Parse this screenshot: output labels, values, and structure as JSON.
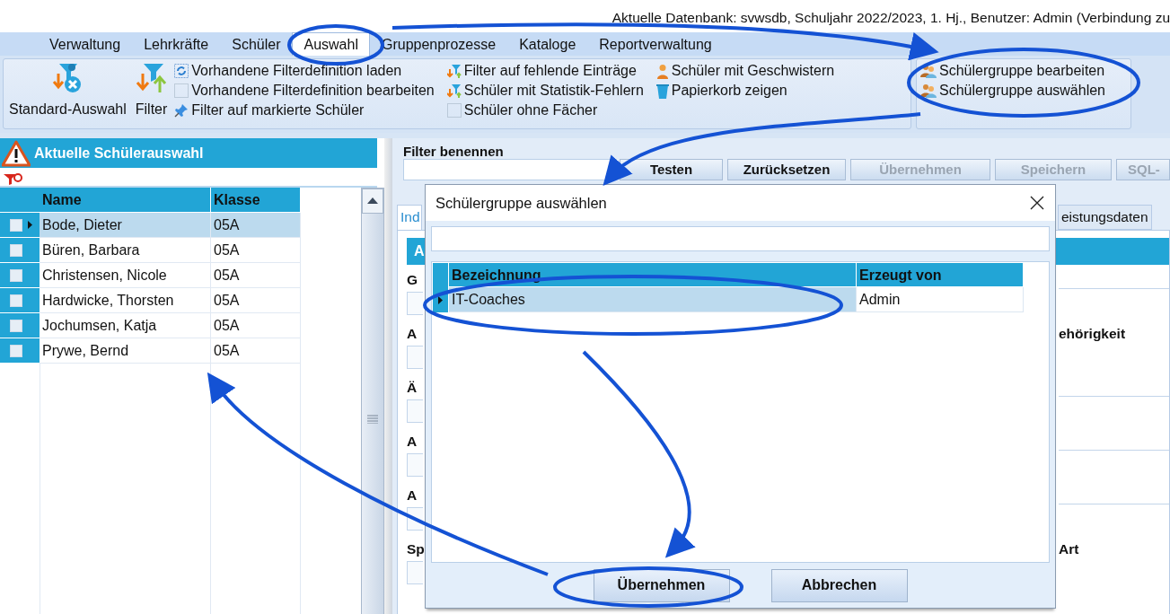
{
  "status_text": "Aktuelle Datenbank: svwsdb, Schuljahr 2022/2023, 1. Hj., Benutzer: Admin (Verbindung zu",
  "menu": [
    {
      "label": "Verwaltung",
      "selected": false
    },
    {
      "label": "Lehrkräfte",
      "selected": false
    },
    {
      "label": "Schüler",
      "selected": false
    },
    {
      "label": "Auswahl",
      "selected": true
    },
    {
      "label": "Gruppenprozesse",
      "selected": false
    },
    {
      "label": "Kataloge",
      "selected": false
    },
    {
      "label": "Reportverwaltung",
      "selected": false
    }
  ],
  "ribbon": {
    "large_buttons": [
      {
        "label": "Standard-Auswahl",
        "kind": "clear"
      },
      {
        "label": "Filter",
        "kind": "filter"
      }
    ],
    "columns": [
      [
        {
          "label": "Vorhandene Filterdefinition laden",
          "kind": "refresh"
        },
        {
          "label": "Vorhandene Filterdefinition bearbeiten",
          "kind": "empty"
        },
        {
          "label": "Filter auf markierte Schüler",
          "kind": "pin"
        }
      ],
      [
        {
          "label": "Filter auf fehlende Einträge",
          "kind": "funnel"
        },
        {
          "label": "Schüler mit Statistik-Fehlern",
          "kind": "funnel"
        },
        {
          "label": "Schüler ohne Fächer",
          "kind": "empty"
        }
      ],
      [
        {
          "label": "Schüler mit Geschwistern",
          "kind": "person"
        },
        {
          "label": "Papierkorb zeigen",
          "kind": "trash"
        }
      ]
    ],
    "group_items": [
      {
        "label": "Schülergruppe bearbeiten",
        "kind": "people"
      },
      {
        "label": "Schülergruppe auswählen",
        "kind": "people"
      }
    ]
  },
  "student_panel": {
    "title": "Aktuelle Schülerauswahl",
    "columns": [
      "Name",
      "Klasse"
    ],
    "rows": [
      {
        "name": "Bode, Dieter",
        "class": "05A",
        "selected": true,
        "checked": false
      },
      {
        "name": "Büren, Barbara",
        "class": "05A",
        "selected": false,
        "checked": false
      },
      {
        "name": "Christensen, Nicole",
        "class": "05A",
        "selected": false,
        "checked": false
      },
      {
        "name": "Hardwicke, Thorsten",
        "class": "05A",
        "selected": false,
        "checked": false
      },
      {
        "name": "Jochumsen, Katja",
        "class": "05A",
        "selected": false,
        "checked": false
      },
      {
        "name": "Prywe, Bernd",
        "class": "05A",
        "selected": false,
        "checked": false
      }
    ]
  },
  "filter_panel": {
    "label": "Filter benennen",
    "buttons": [
      {
        "label": "Testen",
        "disabled": false
      },
      {
        "label": "Zurücksetzen",
        "disabled": false
      },
      {
        "label": "Übernehmen",
        "disabled": true
      },
      {
        "label": "Speichern",
        "disabled": true
      },
      {
        "label": "SQL-",
        "disabled": true
      }
    ],
    "tabs": [
      {
        "label": "Ind",
        "selected": true
      },
      {
        "label": "eistungsdaten",
        "selected": false
      }
    ],
    "section_header": "A",
    "form_rows": [
      {
        "left_label": "G"
      },
      {
        "left_label": "A",
        "right_label": "ehörigkeit"
      },
      {
        "left_label": "Ä"
      },
      {
        "left_label": "A"
      },
      {
        "left_label": "A"
      },
      {
        "left_label": "Sp",
        "right_label": "Art"
      }
    ]
  },
  "dialog": {
    "title": "Schülergruppe auswählen",
    "columns": [
      "Bezeichnung",
      "Erzeugt von"
    ],
    "rows": [
      {
        "name": "IT-Coaches",
        "created_by": "Admin",
        "selected": true
      }
    ],
    "buttons": [
      "Übernehmen",
      "Abbrechen"
    ]
  }
}
